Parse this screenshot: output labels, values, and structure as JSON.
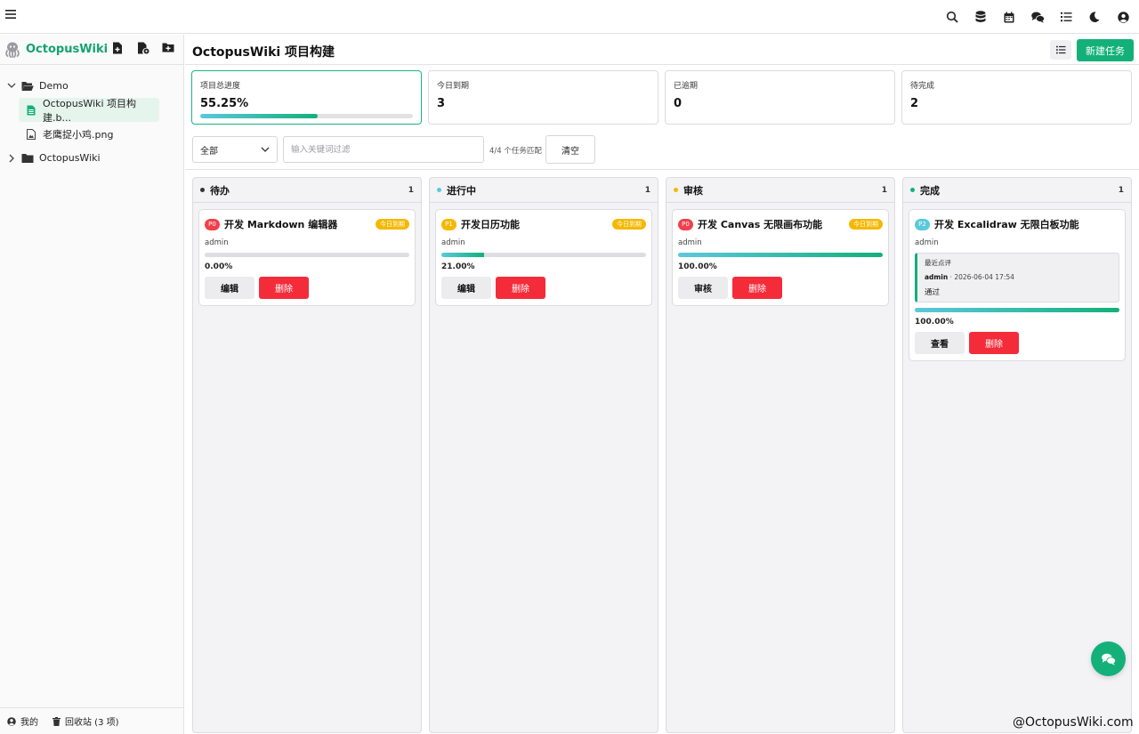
{
  "app": {
    "brand": "OctopusWiki",
    "top_icons": [
      "search-icon",
      "database-icon",
      "calendar-icon",
      "chat-icon",
      "list-icon",
      "moon-icon",
      "user-circle-icon"
    ]
  },
  "sidebar": {
    "tree": [
      {
        "type": "folder",
        "label": "Demo",
        "expanded": true
      },
      {
        "type": "file",
        "label": "OctopusWiki 项目构建.b...",
        "active": true
      },
      {
        "type": "file",
        "label": "老鹰捉小鸡.png",
        "active": false
      },
      {
        "type": "folder",
        "label": "OctopusWiki",
        "expanded": false
      }
    ],
    "footer": {
      "mine": "我的",
      "trash": "回收站 (3 项)"
    }
  },
  "header": {
    "title": "OctopusWiki 项目构建",
    "new_button": "新建任务"
  },
  "stats": [
    {
      "label": "项目总进度",
      "value": "55.25%",
      "progress": 55.25
    },
    {
      "label": "今日到期",
      "value": "3"
    },
    {
      "label": "已逾期",
      "value": "0"
    },
    {
      "label": "待完成",
      "value": "2"
    }
  ],
  "filter": {
    "select_value": "全部",
    "keyword_placeholder": "输入关键词过滤",
    "match_text": "4/4 个任务匹配",
    "clear_label": "清空"
  },
  "columns": [
    {
      "title": "待办",
      "count": "1",
      "dot_color": "#333333",
      "card": {
        "priority": "P0",
        "priority_color": "#f0404c",
        "title": "开发 Markdown 编辑器",
        "due": "今日到期",
        "owner": "admin",
        "progress": 0,
        "progress_text": "0.00%",
        "primary": "编辑",
        "delete": "删除"
      }
    },
    {
      "title": "进行中",
      "count": "1",
      "dot_color": "#5cc8dc",
      "card": {
        "priority": "P1",
        "priority_color": "#f5b800",
        "title": "开发日历功能",
        "due": "今日到期",
        "owner": "admin",
        "progress": 21,
        "progress_text": "21.00%",
        "primary": "编辑",
        "delete": "删除"
      }
    },
    {
      "title": "审核",
      "count": "1",
      "dot_color": "#f5b800",
      "card": {
        "priority": "P0",
        "priority_color": "#f0404c",
        "title": "开发 Canvas 无限画布功能",
        "due": "今日到期",
        "owner": "admin",
        "progress": 100,
        "progress_text": "100.00%",
        "primary": "审核",
        "delete": "删除"
      }
    },
    {
      "title": "完成",
      "count": "1",
      "dot_color": "#13b07a",
      "card": {
        "priority": "P2",
        "priority_color": "#5cc8dc",
        "title": "开发 Excalidraw 无限白板功能",
        "owner": "admin",
        "progress": 100,
        "progress_text": "100.00%",
        "primary": "查看",
        "delete": "删除",
        "review": {
          "label": "最近点评",
          "user": "admin",
          "time": "2026-06-04 17:54",
          "text": "通过"
        }
      }
    }
  ],
  "watermark": "@OctopusWiki.com",
  "colors": {
    "accent": "#13b07a",
    "danger": "#f42c3a",
    "warning": "#f5b800",
    "info": "#5cc8dc"
  }
}
